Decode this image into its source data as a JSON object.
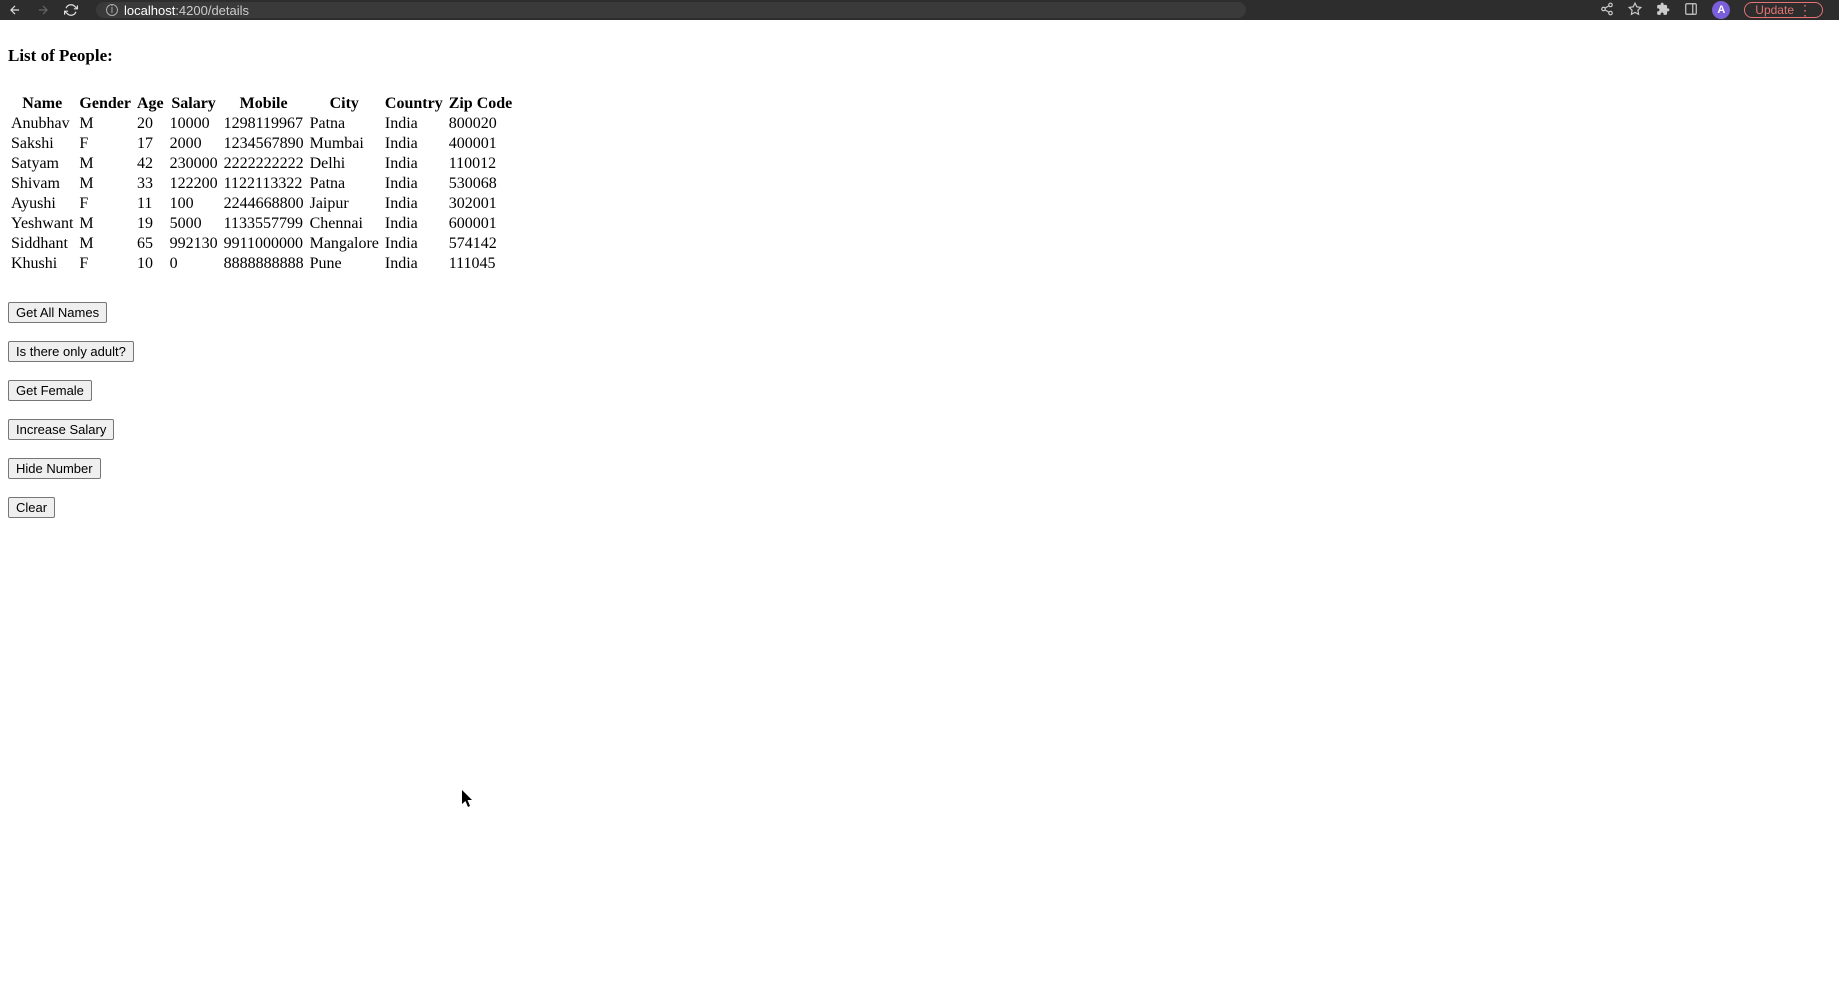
{
  "browser": {
    "url_host": "localhost",
    "url_path": ":4200/details",
    "update_label": "Update",
    "avatar_letter": "A"
  },
  "page": {
    "title": "List of People:"
  },
  "table": {
    "headers": [
      "Name",
      "Gender",
      "Age",
      "Salary",
      "Mobile",
      "City",
      "Country",
      "Zip Code"
    ],
    "rows": [
      {
        "name": "Anubhav",
        "gender": "M",
        "age": "20",
        "salary": "10000",
        "mobile": "1298119967",
        "city": "Patna",
        "country": "India",
        "zip": "800020"
      },
      {
        "name": "Sakshi",
        "gender": "F",
        "age": "17",
        "salary": "2000",
        "mobile": "1234567890",
        "city": "Mumbai",
        "country": "India",
        "zip": "400001"
      },
      {
        "name": "Satyam",
        "gender": "M",
        "age": "42",
        "salary": "230000",
        "mobile": "2222222222",
        "city": "Delhi",
        "country": "India",
        "zip": "110012"
      },
      {
        "name": "Shivam",
        "gender": "M",
        "age": "33",
        "salary": "122200",
        "mobile": "1122113322",
        "city": "Patna",
        "country": "India",
        "zip": "530068"
      },
      {
        "name": "Ayushi",
        "gender": "F",
        "age": "11",
        "salary": "100",
        "mobile": "2244668800",
        "city": "Jaipur",
        "country": "India",
        "zip": "302001"
      },
      {
        "name": "Yeshwant",
        "gender": "M",
        "age": "19",
        "salary": "5000",
        "mobile": "1133557799",
        "city": "Chennai",
        "country": "India",
        "zip": "600001"
      },
      {
        "name": "Siddhant",
        "gender": "M",
        "age": "65",
        "salary": "992130",
        "mobile": "9911000000",
        "city": "Mangalore",
        "country": "India",
        "zip": "574142"
      },
      {
        "name": "Khushi",
        "gender": "F",
        "age": "10",
        "salary": "0",
        "mobile": "8888888888",
        "city": "Pune",
        "country": "India",
        "zip": "111045"
      }
    ]
  },
  "buttons": {
    "get_all_names": "Get All Names",
    "is_only_adult": "Is there only adult?",
    "get_female": "Get Female",
    "increase_salary": "Increase Salary",
    "hide_number": "Hide Number",
    "clear": "Clear"
  }
}
